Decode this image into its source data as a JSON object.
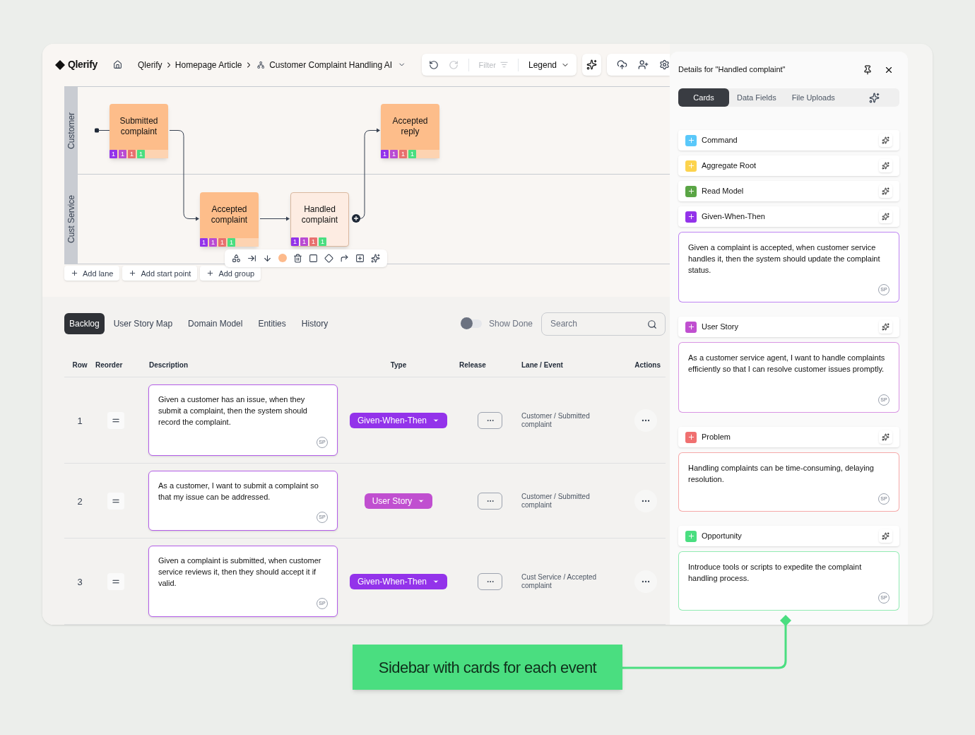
{
  "app": {
    "logo": "Qlerify"
  },
  "breadcrumbs": [
    {
      "label": "Qlerify",
      "kind": "text"
    },
    {
      "label": "Homepage Article",
      "kind": "text"
    },
    {
      "label": "Customer Complaint Handling AI",
      "kind": "diagram"
    }
  ],
  "history_buttons": [
    {
      "kind": "undo",
      "disabled": false
    },
    {
      "kind": "redo",
      "disabled": true
    }
  ],
  "filter": {
    "label": "Filter",
    "disabled": true
  },
  "legend": {
    "label": "Legend"
  },
  "canvas": {
    "lanes": [
      {
        "label": "Customer"
      },
      {
        "label": "Cust Service"
      }
    ],
    "nodes": [
      {
        "title": "Submitted complaint",
        "selected": false,
        "badges": [
          {
            "text": "1",
            "color": "#9333ea"
          },
          {
            "text": "1",
            "color": "#b94bd3"
          },
          {
            "text": "1",
            "color": "#e8706f"
          },
          {
            "text": "1",
            "color": "#4ade80"
          }
        ]
      },
      {
        "title": "Accepted complaint",
        "selected": false,
        "badges": [
          {
            "text": "1",
            "color": "#9333ea"
          },
          {
            "text": "1",
            "color": "#b94bd3"
          },
          {
            "text": "1",
            "color": "#e8706f"
          },
          {
            "text": "1",
            "color": "#4ade80"
          }
        ]
      },
      {
        "title": "Handled complaint",
        "selected": true,
        "badges": [
          {
            "text": "1",
            "color": "#9333ea"
          },
          {
            "text": "1",
            "color": "#b94bd3"
          },
          {
            "text": "1",
            "color": "#e8706f"
          },
          {
            "text": "1",
            "color": "#4ade80"
          }
        ]
      },
      {
        "title": "Accepted reply",
        "selected": false,
        "badges": [
          {
            "text": "1",
            "color": "#9333ea"
          },
          {
            "text": "1",
            "color": "#b94bd3"
          },
          {
            "text": "1",
            "color": "#e8706f"
          },
          {
            "text": "1",
            "color": "#4ade80"
          }
        ]
      }
    ],
    "node_toolbar": {
      "color": "#fdba8c"
    },
    "actions": [
      {
        "label": "Add lane"
      },
      {
        "label": "Add start point"
      },
      {
        "label": "Add group"
      }
    ]
  },
  "bottom_tabs": [
    {
      "label": "Backlog",
      "selected": true
    },
    {
      "label": "User Story Map",
      "selected": false
    },
    {
      "label": "Domain Model",
      "selected": false
    },
    {
      "label": "Entities",
      "selected": false
    },
    {
      "label": "History",
      "selected": false
    }
  ],
  "show_done": {
    "label": "Show Done",
    "on": false
  },
  "search": {
    "placeholder": "Search"
  },
  "table": {
    "columns": [
      "Row",
      "Reorder",
      "Description",
      "Type",
      "Release",
      "Lane / Event",
      "Actions"
    ],
    "rows": [
      {
        "row": "1",
        "description": "Given a customer has an issue, when they submit a complaint, then the system should record the complaint.",
        "badge": "SP",
        "type": {
          "label": "Given-When-Then",
          "color": "#9333ea"
        },
        "lane_event": "Customer / Submitted complaint"
      },
      {
        "row": "2",
        "description": "As a customer, I want to submit a complaint so that my issue can be addressed.",
        "badge": "SP",
        "type": {
          "label": "User Story",
          "color": "#c04fd0"
        },
        "lane_event": "Customer / Submitted complaint"
      },
      {
        "row": "3",
        "description": "Given a complaint is submitted, when customer service reviews it, then they should accept it if valid.",
        "badge": "SP",
        "type": {
          "label": "Given-When-Then",
          "color": "#9333ea"
        },
        "lane_event": "Cust Service / Accepted complaint"
      }
    ]
  },
  "sidebar": {
    "title": "Details for \"Handled complaint\"",
    "tabs": [
      {
        "label": "Cards",
        "selected": true
      },
      {
        "label": "Data Fields",
        "selected": false
      },
      {
        "label": "File Uploads",
        "selected": false
      }
    ],
    "cards": [
      {
        "label": "Command",
        "color": "#5ac8fa"
      },
      {
        "label": "Aggregate Root",
        "color": "#fcd34d"
      },
      {
        "label": "Read Model",
        "color": "#5aa545"
      },
      {
        "label": "Given-When-Then",
        "color": "#9333ea",
        "text": "Given a complaint is accepted, when customer service handles it, then the system should update the complaint status.",
        "badge": "SP"
      },
      {
        "label": "User Story",
        "color": "#c04fd0",
        "text": "As a customer service agent, I want to handle complaints efficiently so that I can resolve customer issues promptly.",
        "badge": "SP"
      },
      {
        "label": "Problem",
        "color": "#f07070",
        "text": "Handling complaints can be time-consuming, delaying resolution.",
        "badge": "SP"
      },
      {
        "label": "Opportunity",
        "color": "#4ade80",
        "text": "Introduce tools or scripts to expedite the complaint handling process.",
        "badge": "SP"
      }
    ]
  },
  "callout": {
    "text": "Sidebar with cards for each event"
  }
}
